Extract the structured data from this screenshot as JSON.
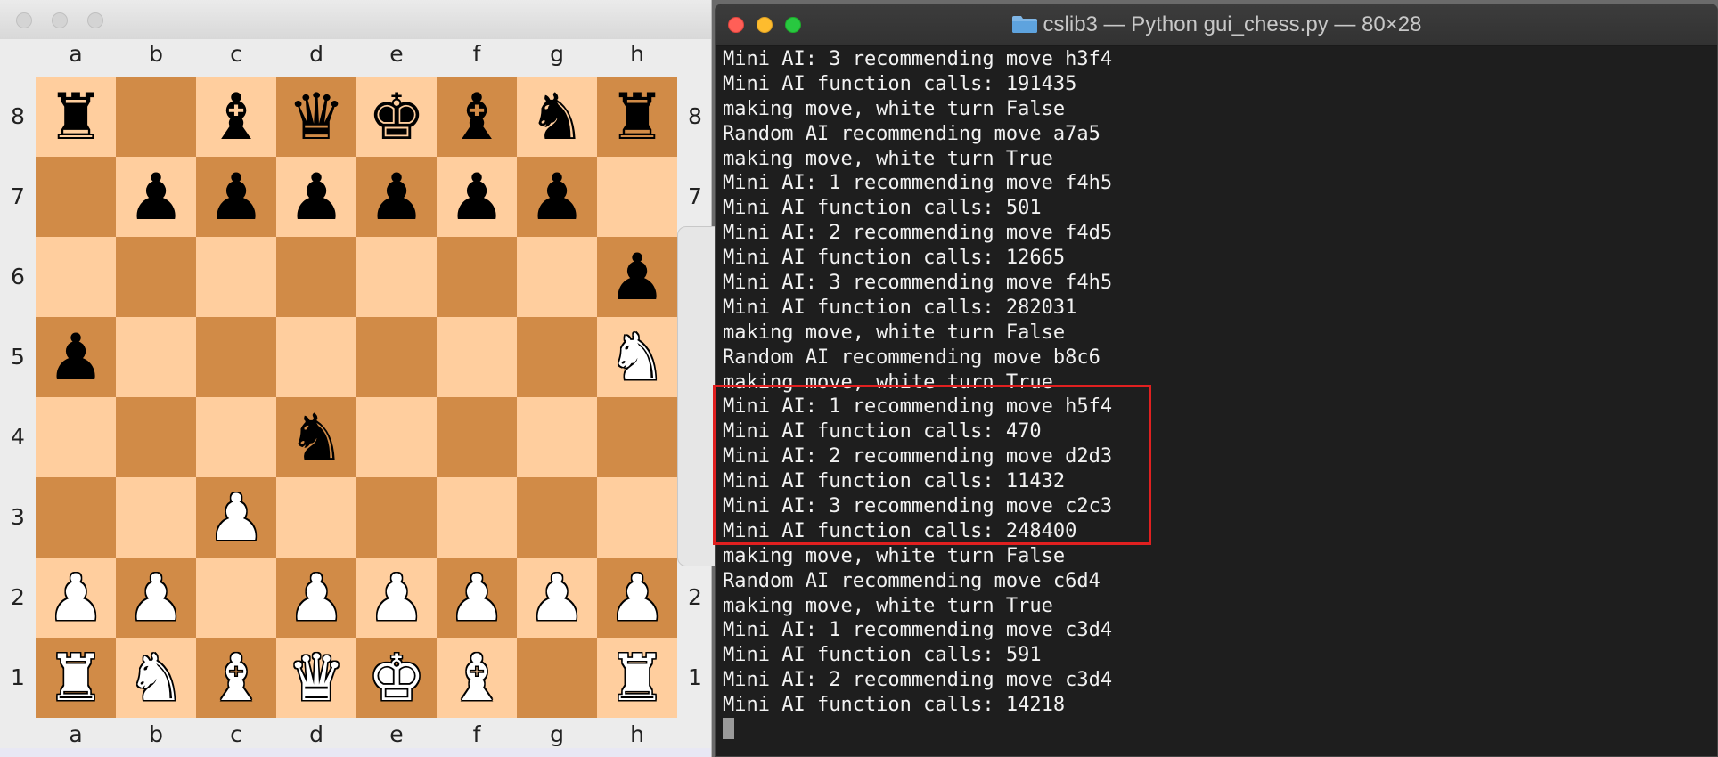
{
  "chess_window": {
    "files": [
      "a",
      "b",
      "c",
      "d",
      "e",
      "f",
      "g",
      "h"
    ],
    "ranks": [
      "8",
      "7",
      "6",
      "5",
      "4",
      "3",
      "2",
      "1"
    ],
    "board": [
      [
        "bR",
        "",
        "bB",
        "bQ",
        "bK",
        "bB",
        "bN",
        "bR"
      ],
      [
        "",
        "bP",
        "bP",
        "bP",
        "bP",
        "bP",
        "bP",
        ""
      ],
      [
        "",
        "",
        "",
        "",
        "",
        "",
        "",
        "bP"
      ],
      [
        "bP",
        "",
        "",
        "",
        "",
        "",
        "",
        "wN"
      ],
      [
        "",
        "",
        "",
        "bN",
        "",
        "",
        "",
        ""
      ],
      [
        "",
        "",
        "wP",
        "",
        "",
        "",
        "",
        ""
      ],
      [
        "wP",
        "wP",
        "",
        "wP",
        "wP",
        "wP",
        "wP",
        "wP"
      ],
      [
        "wR",
        "wN",
        "wB",
        "wQ",
        "wK",
        "wB",
        "",
        "wR"
      ]
    ],
    "piece_glyphs": {
      "K": "♚",
      "Q": "♛",
      "R": "♜",
      "B": "♝",
      "N": "♞",
      "P": "♟"
    },
    "colors": {
      "light_square": "#ffce9e",
      "dark_square": "#d18b47"
    }
  },
  "terminal": {
    "title": "cslib3 — Python gui_chess.py — 80×28",
    "title_icon": "folder-icon",
    "lines": [
      "Mini AI: 3 recommending move h3f4",
      "Mini AI function calls: 191435",
      "making move, white turn False",
      "Random AI recommending move a7a5",
      "making move, white turn True",
      "Mini AI: 1 recommending move f4h5",
      "Mini AI function calls: 501",
      "Mini AI: 2 recommending move f4d5",
      "Mini AI function calls: 12665",
      "Mini AI: 3 recommending move f4h5",
      "Mini AI function calls: 282031",
      "making move, white turn False",
      "Random AI recommending move b8c6",
      "making move, white turn True",
      "Mini AI: 1 recommending move h5f4",
      "Mini AI function calls: 470",
      "Mini AI: 2 recommending move d2d3",
      "Mini AI function calls: 11432",
      "Mini AI: 3 recommending move c2c3",
      "Mini AI function calls: 248400",
      "making move, white turn False",
      "Random AI recommending move c6d4",
      "making move, white turn True",
      "Mini AI: 1 recommending move c3d4",
      "Mini AI function calls: 591",
      "Mini AI: 2 recommending move c3d4",
      "Mini AI function calls: 14218"
    ],
    "highlight_color": "#e02020"
  }
}
